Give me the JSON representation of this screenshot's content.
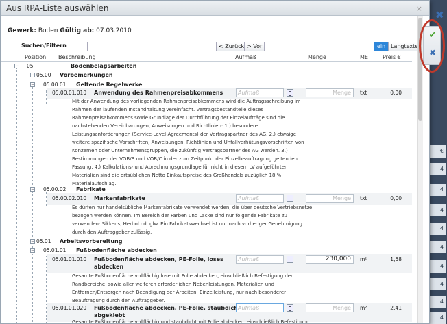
{
  "dialog": {
    "title": "Aus RPA-Liste auswählen",
    "close": "×"
  },
  "gewerk": {
    "label_gewerk": "Gewerk:",
    "gewerk_value": "Boden",
    "label_gueltig": "Gültig ab:",
    "gueltig_value": "07.03.2010"
  },
  "search": {
    "label": "Suchen/Filtern",
    "back": "< Zurück",
    "forward": "> Vor",
    "ein": "ein",
    "langtexte": "Langtexte"
  },
  "columns": {
    "position": "Position",
    "beschreibung": "Beschreibung",
    "aufmass": "Aufmaß",
    "menge": "Menge",
    "me": "ME",
    "preis": "Preis €"
  },
  "placeholders": {
    "aufmass": "Aufmaß",
    "menge": "Menge"
  },
  "rows": {
    "r05": {
      "pos": "05",
      "text": "Bodenbelagsarbeiten"
    },
    "r0500": {
      "pos": "05.00",
      "text": "Vorbemerkungen"
    },
    "r050001": {
      "pos": "05.00.01",
      "text": "Geltende Regelwerke"
    },
    "r05000101": {
      "pos": "05.00.01.010",
      "text": "Anwendung des Rahmenpreisabkommens",
      "me": "txt",
      "preis": "0,00",
      "long": [
        "Mit der Anwendung des vorliegenden Rahmenpreisabkommens wird die Auftragsschreibung im",
        "Rahmen der laufenden Instandhaltung vereinfacht. Vertragsbestandteile dieses",
        "Rahmenpreisabkommens sowie Grundlage der Durchführung der Einzelaufträge sind die",
        "nachstehenden Vereinbarungen, Anweisungen und Richtlinien: 1.) besondere",
        "Leistungsanforderungen (Service-Level-Agreements) der Vertragspartner des AG. 2.) etwaige",
        "weitere spezifische Vorschriften, Anweisungen, Richtlinien und Unfallverhütungsvorschriften von",
        "Konzernen oder Unternehmensgruppen, die zukünftig Vertragspartner des AG werden. 3.)",
        "Bestimmungen der VOB/B und VOB/C in der zum Zeitpunkt der Einzelbeauftragung geltenden",
        "Fassung. 4.) Kalkulations- und Abrechnungsgrundlage für nicht in diesem LV aufgeführten",
        "Materialien sind die ortsüblichen Netto Einkaufspreise des Großhandels zuzüglich 18 %",
        "Materialaufschlag."
      ]
    },
    "r050002": {
      "pos": "05.00.02",
      "text": "Fabrikate"
    },
    "r05000201": {
      "pos": "05.00.02.010",
      "text": "Markenfabrikate",
      "me": "txt",
      "preis": "0,00",
      "long": [
        "Es dürfen nur handelsübliche Markenfabrikate verwendet werden, die über deutsche Vertriebsnetze",
        "bezogen werden können. Im Bereich der Farben und Lacke sind nur folgende Fabrikate zu",
        "verwenden: Sikkens, Herbol od. glw. Ein Fabrikatswechsel ist nur nach vorheriger Genehmigung",
        "durch den Auftraggeber zulässig."
      ]
    },
    "r0501": {
      "pos": "05.01",
      "text": "Arbeitsvorbereitung"
    },
    "r050101": {
      "pos": "05.01.01",
      "text": "Fußbodenfläche abdecken"
    },
    "r05010101": {
      "pos": "05.01.01.010",
      "text1": "Fußbodenfläche abdecken, PE-Folie, loses",
      "text2": "abdecken",
      "menge": "230,000",
      "me": "m²",
      "preis": "1,58",
      "long": [
        "Gesamte Fußbodenfläche vollflächig lose mit Folie abdecken, einschließlich Befestigung der",
        "Randbereiche, sowie aller weiteren erforderlichen Nebenleistungen, Materialien und",
        "Entfernen/Entsorgen nach Beendigung der Arbeiten. Einzelleistung, nur nach besonderer",
        "Beauftragung durch den Auftraggeber."
      ]
    },
    "r05010102": {
      "pos": "05.01.01.020",
      "text1": "Fußbodenfläche abdecken, PE-Folie, staubdicht",
      "text2": "abgeklebt",
      "me": "m²",
      "preis": "2,41",
      "long": [
        "Gesamte Fußbodenfläche vollflächig und staubdicht mit Folie abdecken, einschließlich Befestigung"
      ]
    }
  },
  "side": {
    "ok": "✔",
    "cancel": "✖",
    "outer_close": "✖",
    "cells": [
      "€",
      "4",
      "4",
      "4",
      "4",
      "4",
      "4",
      "4",
      "4",
      "4"
    ]
  }
}
